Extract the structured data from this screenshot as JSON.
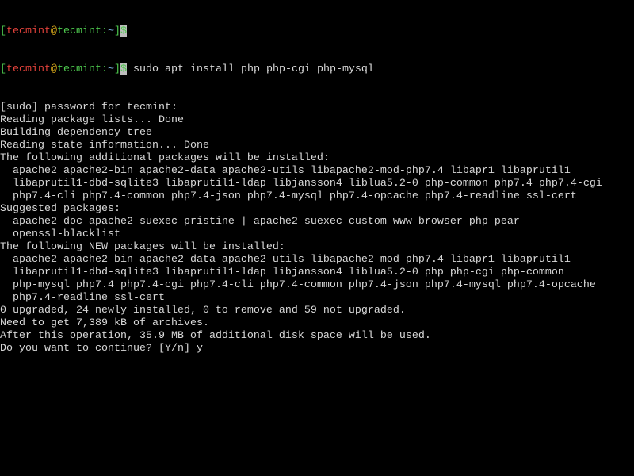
{
  "prompt": {
    "open": "[",
    "user": "tecmint",
    "at": "@",
    "host": "tecmint",
    "colon": ":",
    "path": "~",
    "close": "]",
    "symbol": "$"
  },
  "command": " sudo apt install php php-cgi php-mysql",
  "output": [
    "[sudo] password for tecmint:",
    "Reading package lists... Done",
    "Building dependency tree",
    "Reading state information... Done",
    "The following additional packages will be installed:",
    "  apache2 apache2-bin apache2-data apache2-utils libapache2-mod-php7.4 libapr1 libaprutil1",
    "  libaprutil1-dbd-sqlite3 libaprutil1-ldap libjansson4 liblua5.2-0 php-common php7.4 php7.4-cgi",
    "  php7.4-cli php7.4-common php7.4-json php7.4-mysql php7.4-opcache php7.4-readline ssl-cert",
    "Suggested packages:",
    "  apache2-doc apache2-suexec-pristine | apache2-suexec-custom www-browser php-pear",
    "  openssl-blacklist",
    "The following NEW packages will be installed:",
    "  apache2 apache2-bin apache2-data apache2-utils libapache2-mod-php7.4 libapr1 libaprutil1",
    "  libaprutil1-dbd-sqlite3 libaprutil1-ldap libjansson4 liblua5.2-0 php php-cgi php-common",
    "  php-mysql php7.4 php7.4-cgi php7.4-cli php7.4-common php7.4-json php7.4-mysql php7.4-opcache",
    "  php7.4-readline ssl-cert",
    "0 upgraded, 24 newly installed, 0 to remove and 59 not upgraded.",
    "Need to get 7,389 kB of archives.",
    "After this operation, 35.9 MB of additional disk space will be used.",
    "Do you want to continue? [Y/n] y"
  ],
  "colors": {
    "background": "#000000",
    "text": "#d8d8d8",
    "prompt_green": "#4ec94e",
    "user_red": "#e0413a",
    "at_yellow": "#e8b51c",
    "path_blue": "#7fb8e8"
  }
}
